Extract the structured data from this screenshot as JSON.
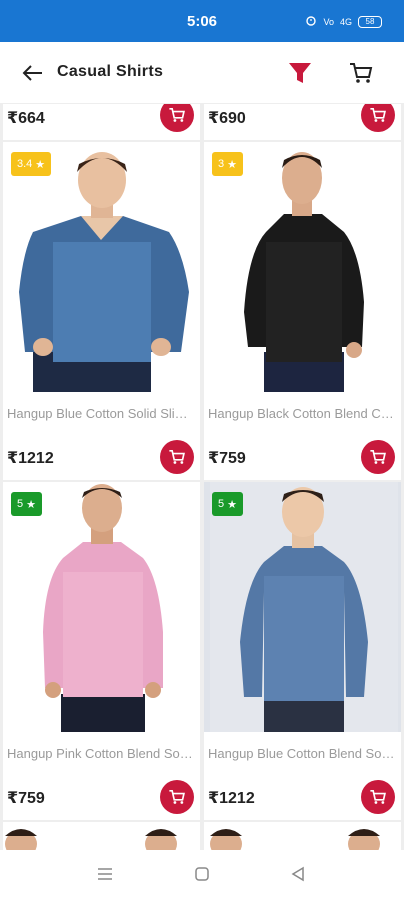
{
  "status_bar": {
    "time": "5:06",
    "signal_text": "4G",
    "battery": "58"
  },
  "app_bar": {
    "title": "Casual Shirts",
    "back_icon": "arrow-left-icon",
    "filter_icon": "filter-icon",
    "cart_icon": "cart-icon"
  },
  "colors": {
    "status_bar": "#1976d2",
    "filter_accent": "#c8193c",
    "cart_button": "#c8193c",
    "rating_yellow": "#f7c21b",
    "rating_green": "#1a9a2a"
  },
  "top_partial_row": [
    {
      "price": "₹664"
    },
    {
      "price": "₹690"
    }
  ],
  "products": [
    {
      "rating": "3.4",
      "name": "Hangup Blue Cotton Solid Slim Fit Casual Shirt",
      "price": "₹1212"
    },
    {
      "rating": "3",
      "name": "Hangup Black Cotton Blend Casual Shirt",
      "price": "₹759"
    },
    {
      "rating": "5",
      "name": "Hangup Pink Cotton Blend Solid Casual Shirt",
      "price": "₹759"
    },
    {
      "rating": "5",
      "name": "Hangup Blue Cotton Blend Solid Casual Shirt",
      "price": "₹1212"
    }
  ]
}
